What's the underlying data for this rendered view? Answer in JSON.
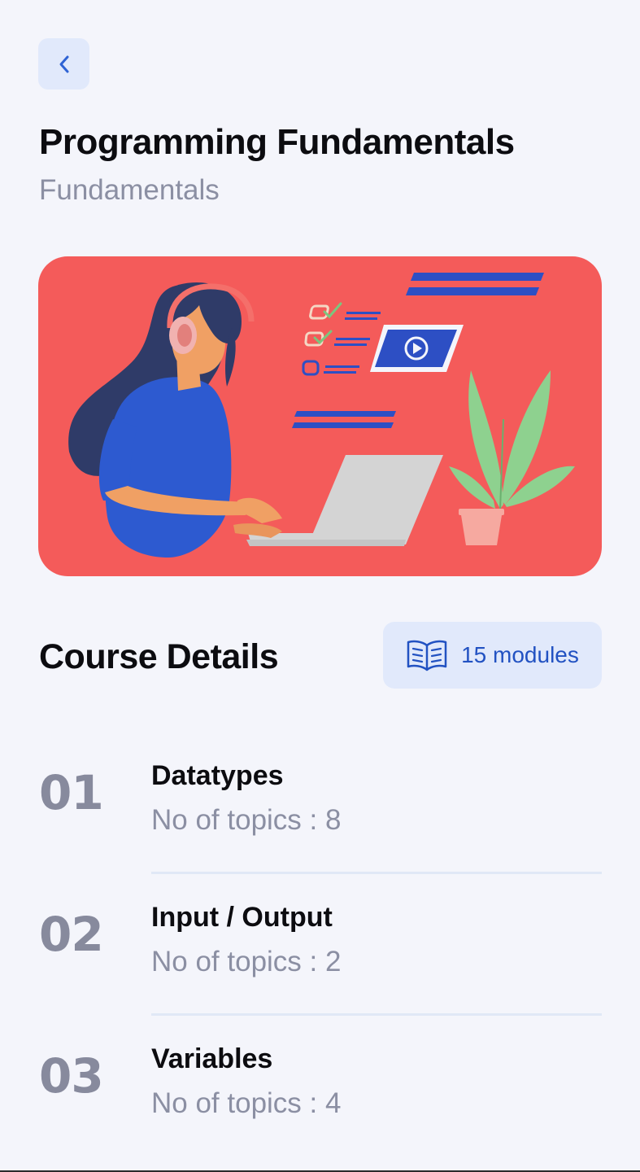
{
  "header": {
    "title": "Programming Fundamentals",
    "subtitle": "Fundamentals"
  },
  "back_button": {
    "icon": "chevron-left-icon",
    "color": "#2f63d4"
  },
  "hero": {
    "background_color": "#f45b5a"
  },
  "course_details": {
    "title": "Course Details",
    "modules_badge": {
      "icon": "open-book-icon",
      "label": "15 modules"
    },
    "modules": [
      {
        "number": "01",
        "name": "Datatypes",
        "topics": "No of topics : 8"
      },
      {
        "number": "02",
        "name": "Input / Output",
        "topics": "No of topics : 2"
      },
      {
        "number": "03",
        "name": "Variables",
        "topics": "No of topics : 4"
      }
    ]
  },
  "colors": {
    "background": "#f4f5fb",
    "accent": "#2252c2",
    "badge_background": "#e1e9fb",
    "muted_text": "#8b8fa3",
    "heading_text": "#0c0c10"
  }
}
